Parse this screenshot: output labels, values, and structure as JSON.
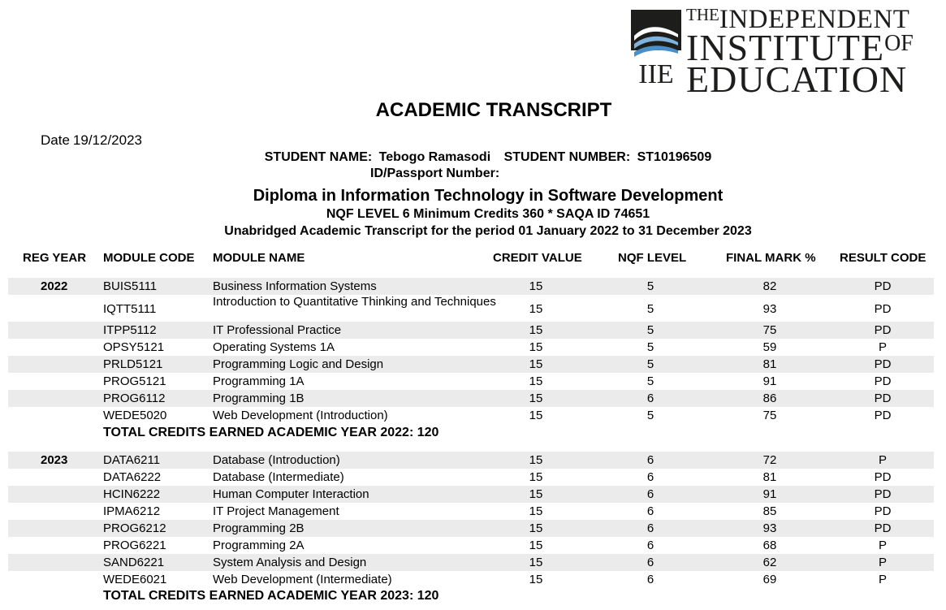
{
  "logo": {
    "mark_text": "IIE",
    "line1_small": "THE",
    "line1": "INDEPENDENT",
    "line2": "INSTITUTE",
    "line2_small": "OF",
    "line3": "EDUCATION",
    "colors": {
      "dark": "#1d1d1b",
      "wave": "#4a90c8"
    }
  },
  "title": "ACADEMIC TRANSCRIPT",
  "date": {
    "label": "Date",
    "value": "19/12/2023"
  },
  "student": {
    "name_label": "STUDENT NAME:",
    "name": "Tebogo Ramasodi",
    "number_label": "STUDENT NUMBER:",
    "number": "ST10196509",
    "id_label": "ID/Passport Number:"
  },
  "program": {
    "name": "Diploma in Information Technology in Software Development",
    "nqf_line": "NQF LEVEL 6 Minimum Credits 360 * SAQA ID 74651",
    "period_line": "Unabridged Academic Transcript for the period 01 January 2022 to 31 December 2023"
  },
  "table": {
    "headers": {
      "reg_year": "REG YEAR",
      "module_code": "MODULE CODE",
      "module_name": "MODULE NAME",
      "credit_value": "CREDIT VALUE",
      "nqf_level": "NQF LEVEL",
      "final_mark": "FINAL MARK %",
      "result_code": "RESULT CODE"
    },
    "years": [
      {
        "year": "2022",
        "total": "TOTAL CREDITS EARNED ACADEMIC YEAR 2022: 120",
        "rows": [
          {
            "code": "BUIS5111",
            "name": "Business Information Systems",
            "credit": "15",
            "nqf": "5",
            "mark": "82",
            "result": "PD"
          },
          {
            "code": "IQTT5111",
            "name": "Introduction to Quantitative Thinking and Techniques",
            "credit": "15",
            "nqf": "5",
            "mark": "93",
            "result": "PD"
          },
          {
            "code": "ITPP5112",
            "name": "IT Professional Practice",
            "credit": "15",
            "nqf": "5",
            "mark": "75",
            "result": "PD"
          },
          {
            "code": "OPSY5121",
            "name": "Operating Systems 1A",
            "credit": "15",
            "nqf": "5",
            "mark": "59",
            "result": "P"
          },
          {
            "code": "PRLD5121",
            "name": "Programming Logic and Design",
            "credit": "15",
            "nqf": "5",
            "mark": "81",
            "result": "PD"
          },
          {
            "code": "PROG5121",
            "name": "Programming 1A",
            "credit": "15",
            "nqf": "5",
            "mark": "91",
            "result": "PD"
          },
          {
            "code": "PROG6112",
            "name": "Programming 1B",
            "credit": "15",
            "nqf": "6",
            "mark": "86",
            "result": "PD"
          },
          {
            "code": "WEDE5020",
            "name": "Web Development (Introduction)",
            "credit": "15",
            "nqf": "5",
            "mark": "75",
            "result": "PD"
          }
        ]
      },
      {
        "year": "2023",
        "total": "TOTAL CREDITS EARNED ACADEMIC YEAR 2023: 120",
        "rows": [
          {
            "code": "DATA6211",
            "name": "Database (Introduction)",
            "credit": "15",
            "nqf": "6",
            "mark": "72",
            "result": "P"
          },
          {
            "code": "DATA6222",
            "name": "Database (Intermediate)",
            "credit": "15",
            "nqf": "6",
            "mark": "81",
            "result": "PD"
          },
          {
            "code": "HCIN6222",
            "name": "Human Computer Interaction",
            "credit": "15",
            "nqf": "6",
            "mark": "91",
            "result": "PD"
          },
          {
            "code": "IPMA6212",
            "name": "IT Project Management",
            "credit": "15",
            "nqf": "6",
            "mark": "85",
            "result": "PD"
          },
          {
            "code": "PROG6212",
            "name": "Programming 2B",
            "credit": "15",
            "nqf": "6",
            "mark": "93",
            "result": "PD"
          },
          {
            "code": "PROG6221",
            "name": "Programming 2A",
            "credit": "15",
            "nqf": "6",
            "mark": "68",
            "result": "P"
          },
          {
            "code": "SAND6221",
            "name": "System Analysis and Design",
            "credit": "15",
            "nqf": "6",
            "mark": "62",
            "result": "P"
          },
          {
            "code": "WEDE6021",
            "name": "Web Development (Intermediate)",
            "credit": "15",
            "nqf": "6",
            "mark": "69",
            "result": "P"
          }
        ]
      }
    ]
  }
}
